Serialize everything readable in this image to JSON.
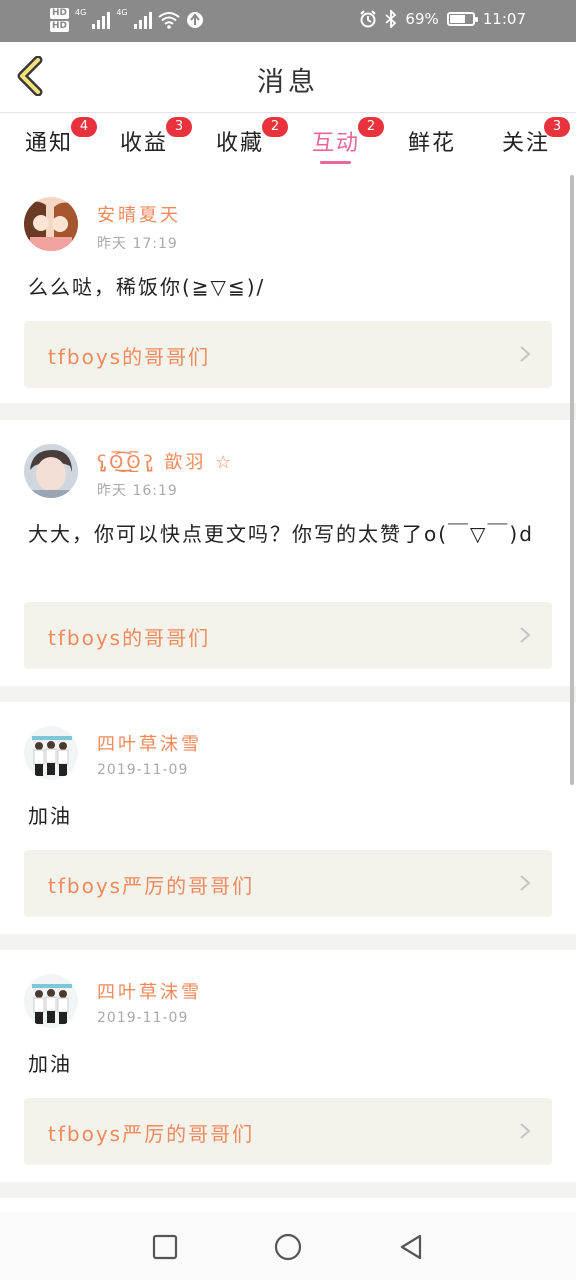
{
  "status_bar": {
    "left_labels": [
      "HD",
      "HD"
    ],
    "network": "4G",
    "network2": "4G",
    "battery_percent_label": "69%",
    "battery_level": 0.69,
    "time": "11:07",
    "icons": [
      "alarm-icon",
      "bluetooth-icon",
      "wifi-icon",
      "signal-icon"
    ]
  },
  "header": {
    "title": "消息",
    "back_icon": "chevron-left-icon"
  },
  "tabs": [
    {
      "label": "通知",
      "badge": "4",
      "active": false
    },
    {
      "label": "收益",
      "badge": "3",
      "active": false
    },
    {
      "label": "收藏",
      "badge": "2",
      "active": false
    },
    {
      "label": "互动",
      "badge": "2",
      "active": true
    },
    {
      "label": "鲜花",
      "badge": "",
      "active": false
    },
    {
      "label": "关注",
      "badge": "3",
      "active": false
    }
  ],
  "messages": [
    {
      "name": "安晴夏天",
      "time": "昨天 17:19",
      "content": "么么哒，稀饭你(≧▽≦)/",
      "link": "tfboys的哥哥们"
    },
    {
      "name": "ʕ̡̢̡ʘ̅͟͜͡ʘ̲̅ʔ̢̡̢ 歆羽 ☆",
      "time": "昨天 16:19",
      "content": "大大，你可以快点更文吗？你写的太赞了o(￣▽￣)d",
      "link": "tfboys的哥哥们"
    },
    {
      "name": "四叶草沫雪",
      "time": "2019-11-09",
      "content": "加油",
      "link": "tfboys严厉的哥哥们"
    },
    {
      "name": "四叶草沫雪",
      "time": "2019-11-09",
      "content": "加油",
      "link": "tfboys严厉的哥哥们"
    }
  ],
  "colors": {
    "accent": "#e8669a",
    "badge": "#e8323c",
    "name": "#f08a5d",
    "link_bg": "#f3f3ec"
  },
  "nav": [
    "recent-apps-icon",
    "home-icon",
    "back-icon"
  ]
}
